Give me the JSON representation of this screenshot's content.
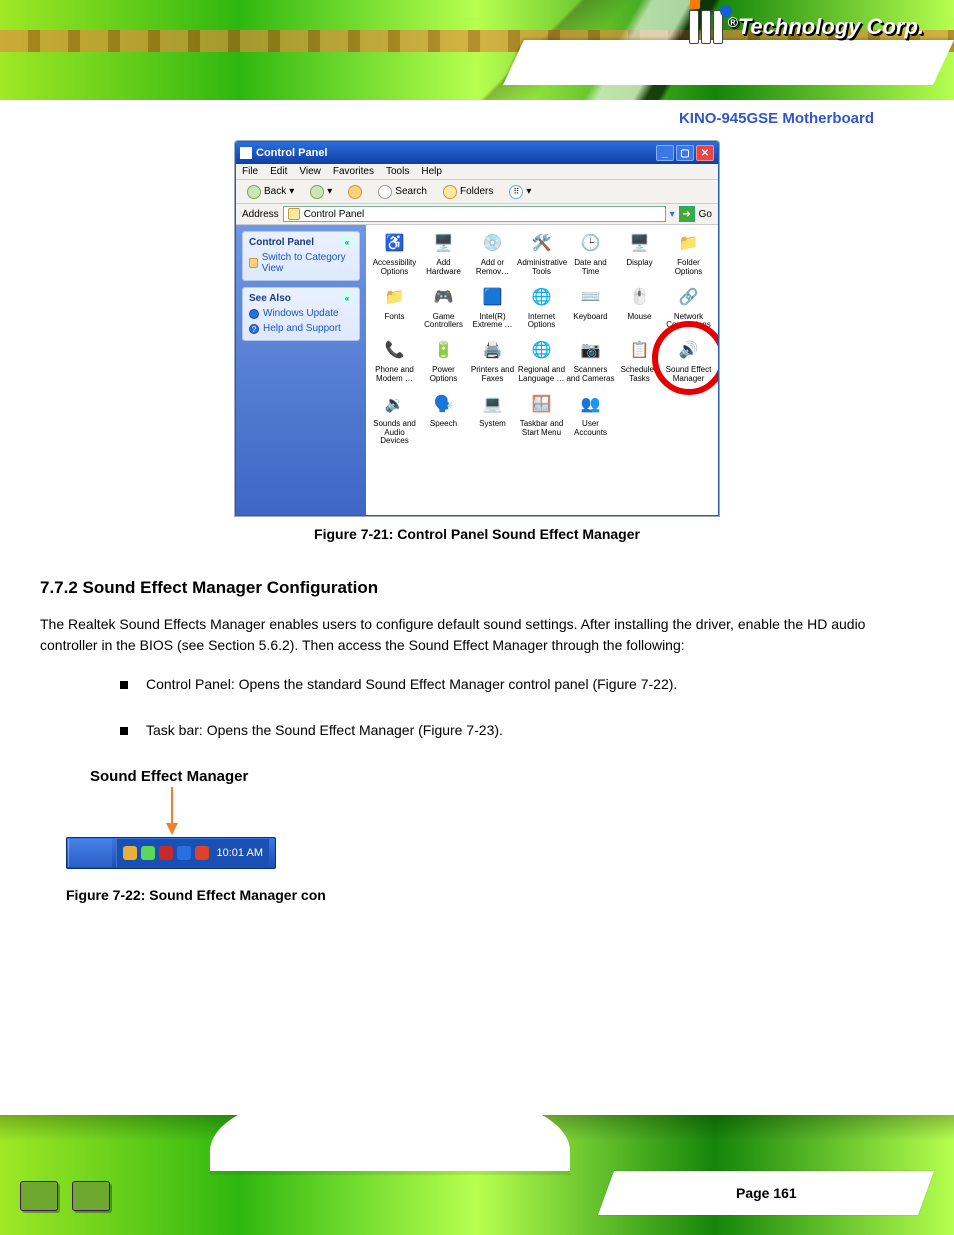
{
  "header": {
    "brand_text": "Technology Corp.",
    "registered": "®"
  },
  "doc": {
    "title": "KINO-945GSE Motherboard",
    "figure_caption_1": "Figure 7-21: Control Panel Sound Effect Manager",
    "section_heading": "7.7.2 Sound Effect Manager Configuration",
    "para_1": "The Realtek Sound Effects Manager enables users to configure default sound settings. After installing the driver, enable the HD audio controller in the BIOS (see Section 5.6.2). Then access the Sound Effect Manager through the following:",
    "bullet_1": "Control Panel: Opens the standard Sound Effect Manager control panel (Figure 7-22).",
    "bullet_2": "Task bar: Opens the Sound Effect Manager (Figure 7-23).",
    "sem_label": "Sound Effect Manager",
    "figure_caption_2": "Figure 7-22: Sound Effect Manager con",
    "page_label": "Page 161"
  },
  "control_panel": {
    "window_title": "Control Panel",
    "menu": [
      "File",
      "Edit",
      "View",
      "Favorites",
      "Tools",
      "Help"
    ],
    "toolbar": {
      "back": "Back",
      "search": "Search",
      "folders": "Folders"
    },
    "address": {
      "label": "Address",
      "value": "Control Panel",
      "go": "Go"
    },
    "sidebar": {
      "card1_title": "Control Panel",
      "card1_link": "Switch to Category View",
      "card2_title": "See Also",
      "card2_link1": "Windows Update",
      "card2_link2": "Help and Support"
    },
    "items": [
      {
        "label": "Accessibility Options",
        "emoji": "♿"
      },
      {
        "label": "Add Hardware",
        "emoji": "🖥️"
      },
      {
        "label": "Add or Remov…",
        "emoji": "💿"
      },
      {
        "label": "Administrative Tools",
        "emoji": "🛠️"
      },
      {
        "label": "Date and Time",
        "emoji": "🕒"
      },
      {
        "label": "Display",
        "emoji": "🖥️"
      },
      {
        "label": "Folder Options",
        "emoji": "📁"
      },
      {
        "label": "Fonts",
        "emoji": "📁"
      },
      {
        "label": "Game Controllers",
        "emoji": "🎮"
      },
      {
        "label": "Intel(R) Extreme …",
        "emoji": "🟦"
      },
      {
        "label": "Internet Options",
        "emoji": "🌐"
      },
      {
        "label": "Keyboard",
        "emoji": "⌨️"
      },
      {
        "label": "Mouse",
        "emoji": "🖱️"
      },
      {
        "label": "Network Connections",
        "emoji": "🔗"
      },
      {
        "label": "Phone and Modem …",
        "emoji": "📞"
      },
      {
        "label": "Power Options",
        "emoji": "🔋"
      },
      {
        "label": "Printers and Faxes",
        "emoji": "🖨️"
      },
      {
        "label": "Regional and Language …",
        "emoji": "🌐"
      },
      {
        "label": "Scanners and Cameras",
        "emoji": "📷"
      },
      {
        "label": "Scheduled Tasks",
        "emoji": "📋"
      },
      {
        "label": "Sound Effect Manager",
        "emoji": "🔊"
      },
      {
        "label": "Sounds and Audio Devices",
        "emoji": "🔉"
      },
      {
        "label": "Speech",
        "emoji": "🗣️"
      },
      {
        "label": "System",
        "emoji": "💻"
      },
      {
        "label": "Taskbar and Start Menu",
        "emoji": "🪟"
      },
      {
        "label": "User Accounts",
        "emoji": "👥"
      }
    ]
  },
  "taskbar": {
    "time": "10:01 AM",
    "tray_icons": [
      {
        "name": "update-icon",
        "color": "#e8b038"
      },
      {
        "name": "network-icon",
        "color": "#5bd85b"
      },
      {
        "name": "sound-effect-manager-icon",
        "color": "#c62a2a"
      },
      {
        "name": "display-icon",
        "color": "#2a6ee0"
      },
      {
        "name": "shield-icon",
        "color": "#e0412a"
      }
    ]
  }
}
